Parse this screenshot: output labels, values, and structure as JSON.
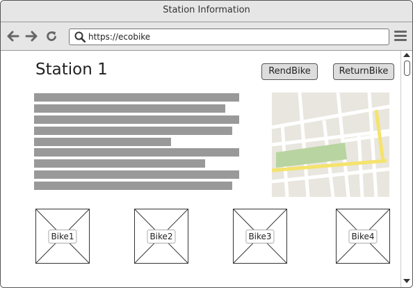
{
  "window": {
    "title": "Station Information"
  },
  "toolbar": {
    "back_icon": "arrow-left-icon",
    "forward_icon": "arrow-right-icon",
    "reload_icon": "reload-icon",
    "url": "https://ecobike",
    "menu_icon": "hamburger-menu-icon"
  },
  "page": {
    "title": "Station 1",
    "rent_button": "RendBike",
    "return_button": "ReturnBike"
  },
  "map": {
    "icon": "map-image",
    "road_color": "#f5e36c",
    "park_color": "#b8d4a0"
  },
  "bikes": [
    {
      "label": "Bike1"
    },
    {
      "label": "Bike2"
    },
    {
      "label": "Bike3"
    },
    {
      "label": "Bike4"
    }
  ]
}
